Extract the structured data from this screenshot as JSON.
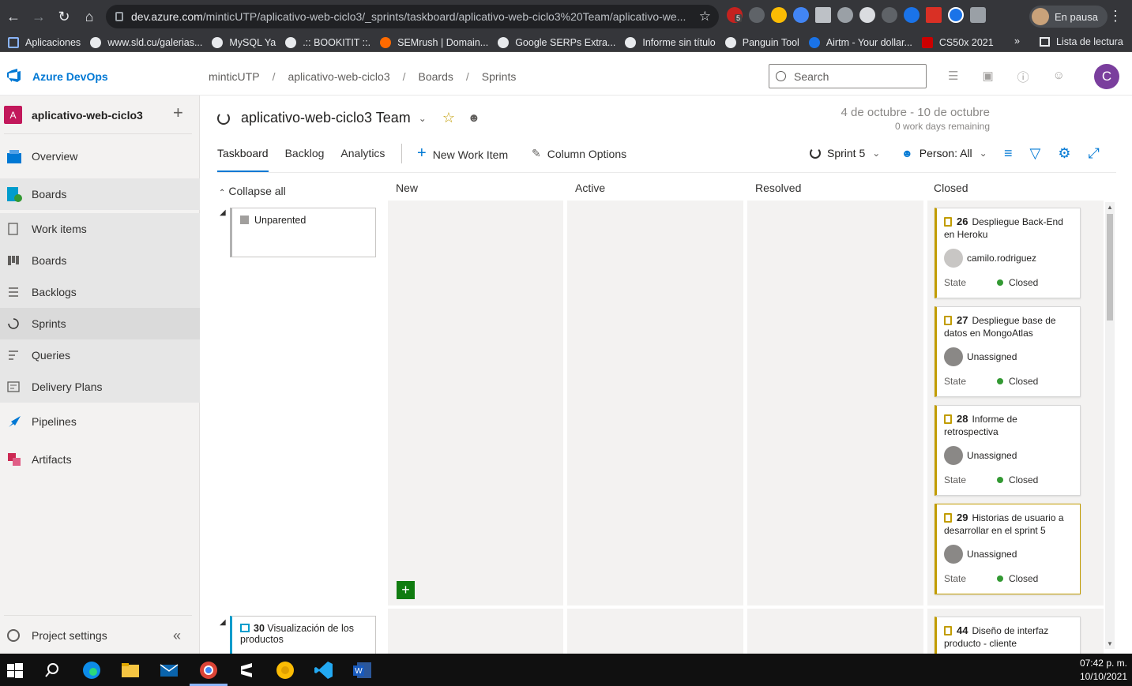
{
  "browser": {
    "url_host": "dev.azure.com",
    "url_path": "/minticUTP/aplicativo-web-ciclo3/_sprints/taskboard/aplicativo-web-ciclo3%20Team/aplicativo-we...",
    "profile_label": "En pausa",
    "ext_badge": "5",
    "bookmarks": [
      "Aplicaciones",
      "www.sld.cu/galerias...",
      "MySQL Ya",
      ".:: BOOKITIT ::.",
      "SEMrush | Domain...",
      "Google SERPs Extra...",
      "Informe sin título",
      "Panguin Tool",
      "Airtm - Your dollar...",
      "CS50x 2021"
    ],
    "reading_list": "Lista de lectura"
  },
  "header": {
    "product": "Azure DevOps",
    "breadcrumb": [
      "minticUTP",
      "aplicativo-web-ciclo3",
      "Boards",
      "Sprints"
    ],
    "search_placeholder": "Search",
    "user_initial": "C"
  },
  "leftnav": {
    "project_initial": "A",
    "project_name": "aplicativo-web-ciclo3",
    "items": [
      "Overview",
      "Boards",
      "Work items",
      "Boards",
      "Backlogs",
      "Sprints",
      "Queries",
      "Delivery Plans",
      "Pipelines",
      "Artifacts"
    ],
    "settings": "Project settings"
  },
  "main": {
    "team": "aplicativo-web-ciclo3 Team",
    "dates": "4 de octubre - 10 de octubre",
    "remaining": "0 work days remaining",
    "tabs": [
      "Taskboard",
      "Backlog",
      "Analytics"
    ],
    "new_item": "New Work Item",
    "column_options": "Column Options",
    "sprint": "Sprint 5",
    "person": "Person: All",
    "collapse_all": "Collapse all",
    "columns": [
      "New",
      "Active",
      "Resolved",
      "Closed"
    ],
    "rows": [
      {
        "parent": "Unparented"
      },
      {
        "parent_id": "30",
        "parent": "Visualización de los productos"
      }
    ],
    "cards": [
      {
        "id": "26",
        "title": "Despliegue Back-End en Heroku",
        "assignee": "camilo.rodriguez",
        "state_label": "State",
        "state": "Closed"
      },
      {
        "id": "27",
        "title": "Despliegue base de datos en MongoAtlas",
        "assignee": "Unassigned",
        "state_label": "State",
        "state": "Closed"
      },
      {
        "id": "28",
        "title": "Informe de retrospectiva",
        "assignee": "Unassigned",
        "state_label": "State",
        "state": "Closed"
      },
      {
        "id": "29",
        "title": "Historias de usuario a desarrollar en el sprint 5",
        "assignee": "Unassigned",
        "state_label": "State",
        "state": "Closed"
      },
      {
        "id": "44",
        "title": "Diseño de interfaz producto - cliente"
      }
    ]
  },
  "taskbar": {
    "time": "07:42 p. m.",
    "date": "10/10/2021"
  }
}
